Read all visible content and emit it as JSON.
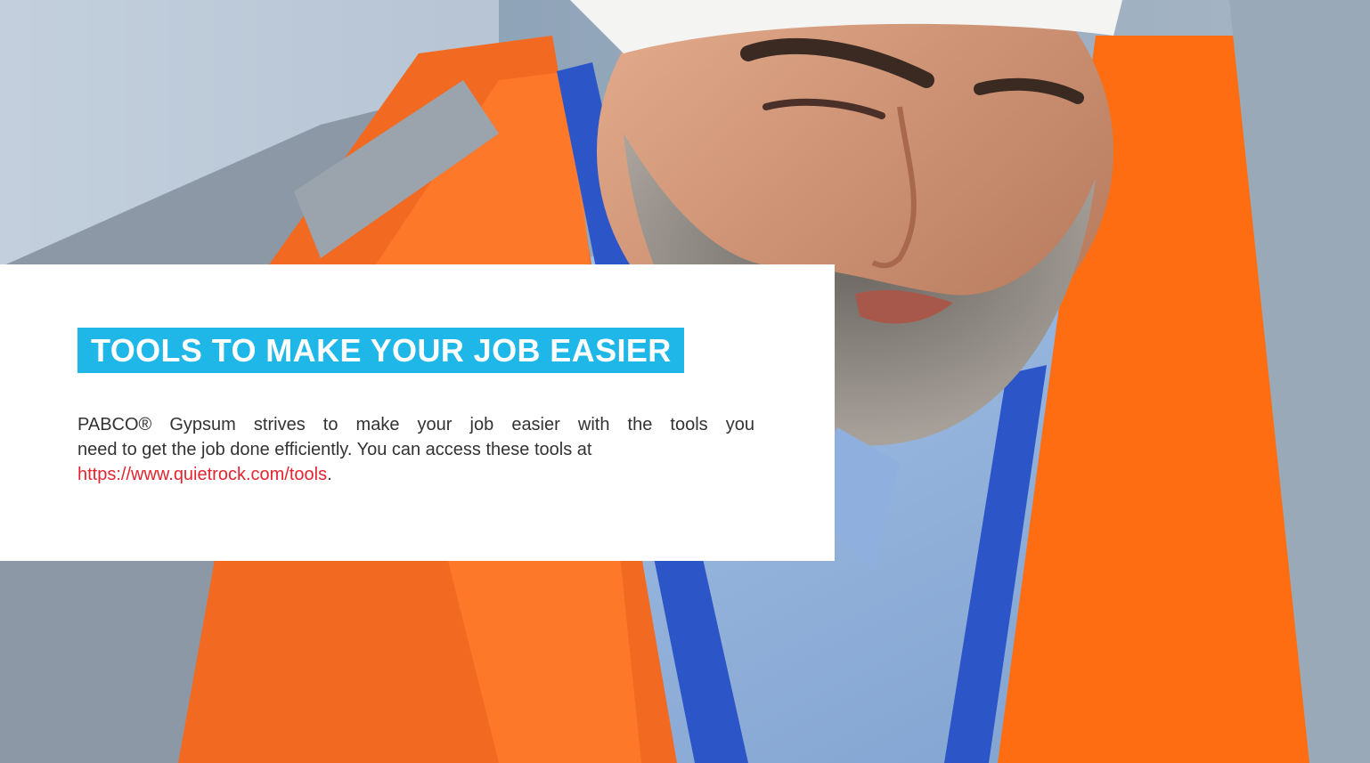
{
  "hero": {
    "image": "photo-worker-hard-hat-safety-vest"
  },
  "card": {
    "heading": "TOOLS TO MAKE YOUR JOB EASIER",
    "body_line1": "PABCO® Gypsum strives to make your job easier with the tools you",
    "body_line2": "need to get the job done efficiently. You can access these tools at",
    "link_text": "https://www.quietrock.com/tools",
    "link_suffix": "."
  },
  "colors": {
    "heading_bg": "#1fb6e8",
    "heading_text": "#ffffff",
    "body_text": "#333333",
    "link": "#e2252f",
    "card_bg": "#ffffff"
  }
}
